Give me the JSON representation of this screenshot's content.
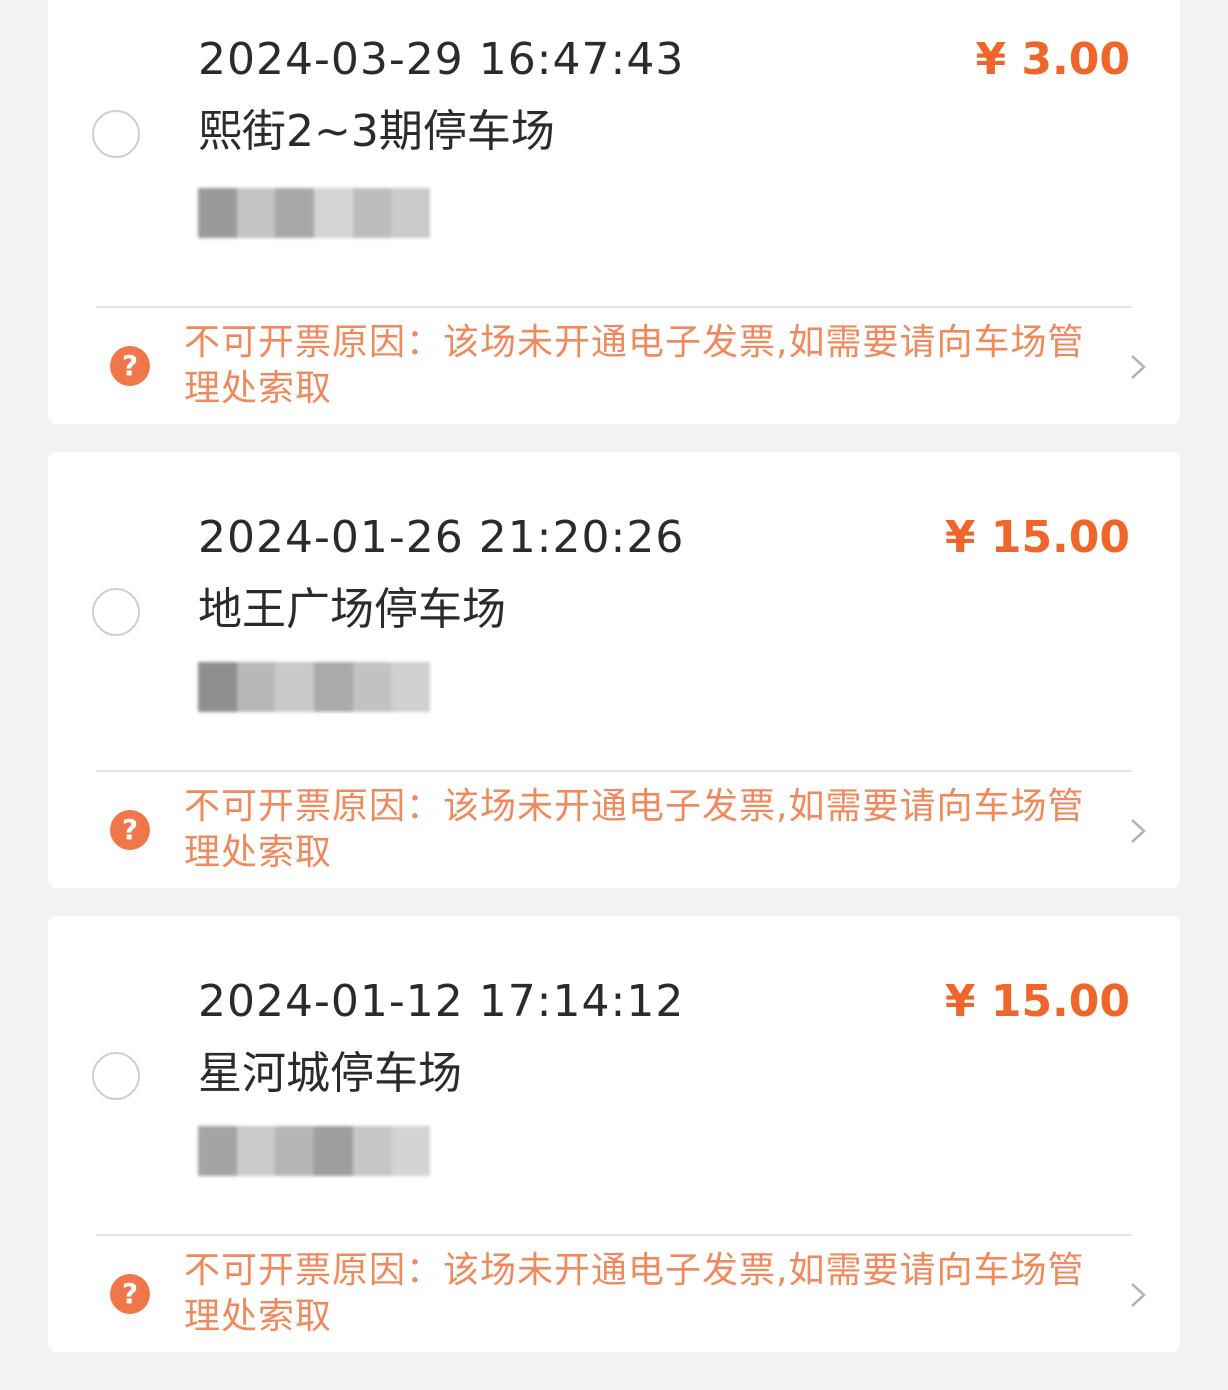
{
  "records": [
    {
      "datetime": "2024-03-29 16:47:43",
      "price": "¥ 3.00",
      "lot_name": "熙街2~3期停车场",
      "reason": "不可开票原因：该场未开通电子发票,如需要请向车场管理处索取"
    },
    {
      "datetime": "2024-01-26 21:20:26",
      "price": "¥ 15.00",
      "lot_name": "地王广场停车场",
      "reason": "不可开票原因：该场未开通电子发票,如需要请向车场管理处索取"
    },
    {
      "datetime": "2024-01-12 17:14:12",
      "price": "¥ 15.00",
      "lot_name": "星河城停车场",
      "reason": "不可开票原因：该场未开通电子发票,如需要请向车场管理处索取"
    }
  ],
  "icons": {
    "help": "help-circle-icon",
    "chevron": "chevron-right-icon",
    "select": "radio-unchecked-icon"
  },
  "colors": {
    "price": "#f0652a",
    "reason": "#f08a5d",
    "help_icon": "#f0774a",
    "text": "#2b2b2b",
    "background": "#f3f2f2"
  }
}
